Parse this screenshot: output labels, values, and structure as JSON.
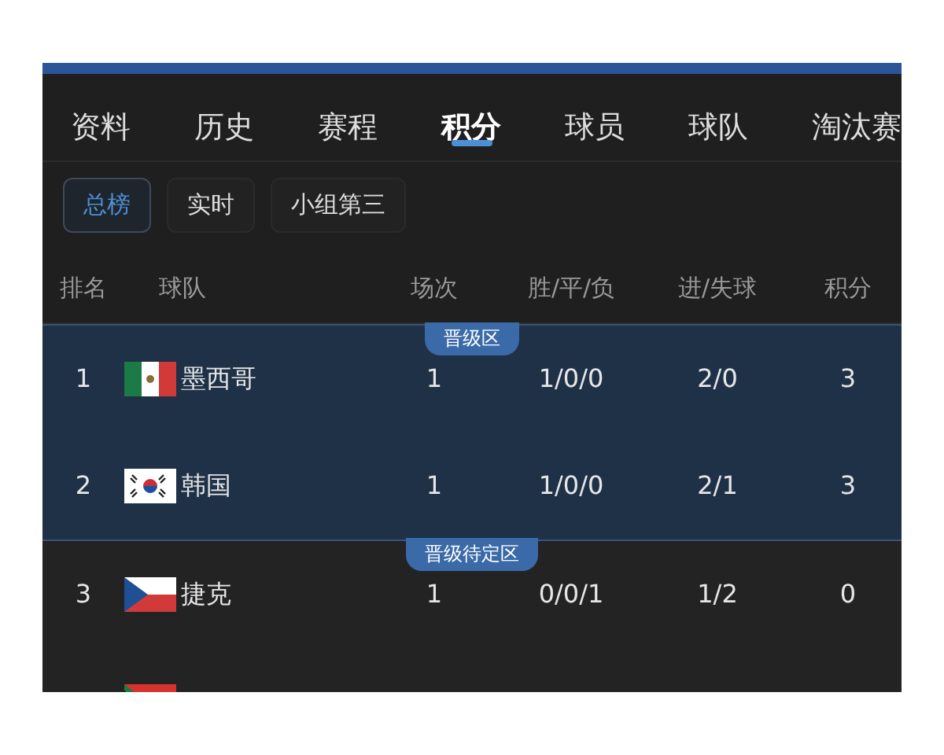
{
  "tabs": [
    {
      "label": "资料",
      "selected": false
    },
    {
      "label": "历史",
      "selected": false
    },
    {
      "label": "赛程",
      "selected": false
    },
    {
      "label": "积分",
      "selected": true
    },
    {
      "label": "球员",
      "selected": false
    },
    {
      "label": "球队",
      "selected": false
    },
    {
      "label": "淘汰赛",
      "selected": false
    }
  ],
  "filters": [
    {
      "label": "总榜",
      "selected": true
    },
    {
      "label": "实时",
      "selected": false
    },
    {
      "label": "小组第三",
      "selected": false
    }
  ],
  "table": {
    "columns": [
      "排名",
      "球队",
      "场次",
      "胜/平/负",
      "进/失球",
      "积分"
    ],
    "zones": [
      {
        "label": "晋级区",
        "kind": "promotion",
        "rows": [
          {
            "rank": "1",
            "kind": "mexico",
            "team": "墨西哥",
            "played": "1",
            "wdl": "1/0/0",
            "goals": "2/0",
            "points": "3"
          },
          {
            "rank": "2",
            "kind": "korea",
            "team": "韩国",
            "played": "1",
            "wdl": "1/0/0",
            "goals": "2/1",
            "points": "3"
          }
        ]
      },
      {
        "label": "晋级待定区",
        "kind": "pending",
        "rows": [
          {
            "rank": "3",
            "kind": "czech",
            "team": "捷克",
            "played": "1",
            "wdl": "0/0/1",
            "goals": "1/2",
            "points": "0"
          },
          {
            "kind": "southafrica"
          }
        ]
      }
    ]
  }
}
